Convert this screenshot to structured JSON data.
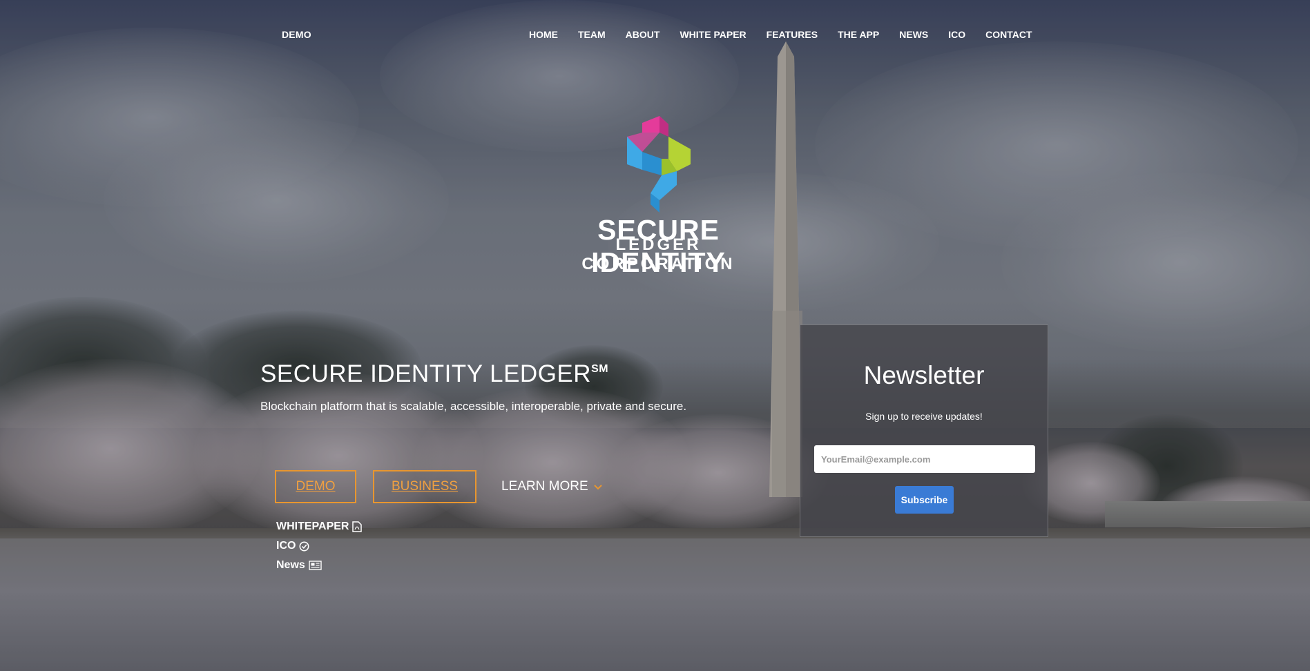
{
  "nav": {
    "left_link": "DEMO",
    "items": [
      "HOME",
      "TEAM",
      "ABOUT",
      "WHITE PAPER",
      "FEATURES",
      "THE APP",
      "NEWS",
      "ICO",
      "CONTACT"
    ]
  },
  "logo": {
    "line1": "SECURE IDENTITY",
    "line2": "LEDGER CORPORATION",
    "icon": "sil-cube-logo-icon"
  },
  "hero": {
    "title": "SECURE IDENTITY LEDGER",
    "title_mark": "SM",
    "subtitle": "Blockchain platform that is scalable, accessible, interoperable, private and secure.",
    "buttons": {
      "demo": "DEMO",
      "business": "BUSINESS",
      "learn_more": "LEARN MORE"
    },
    "quick_links": [
      {
        "label": "WHITEPAPER",
        "icon": "pdf-file-icon"
      },
      {
        "label": "ICO",
        "icon": "check-circle-icon"
      },
      {
        "label": "News",
        "icon": "newspaper-icon"
      }
    ]
  },
  "newsletter": {
    "title": "Newsletter",
    "subtitle": "Sign up to receive updates!",
    "email_placeholder": "YourEmail@example.com",
    "subscribe_label": "Subscribe"
  },
  "colors": {
    "accent_orange": "#e8962f",
    "subscribe_blue": "#3a7bd5",
    "logo_pink": "#e43b9a",
    "logo_lime": "#b5d334",
    "logo_blue": "#3fa9e6"
  }
}
